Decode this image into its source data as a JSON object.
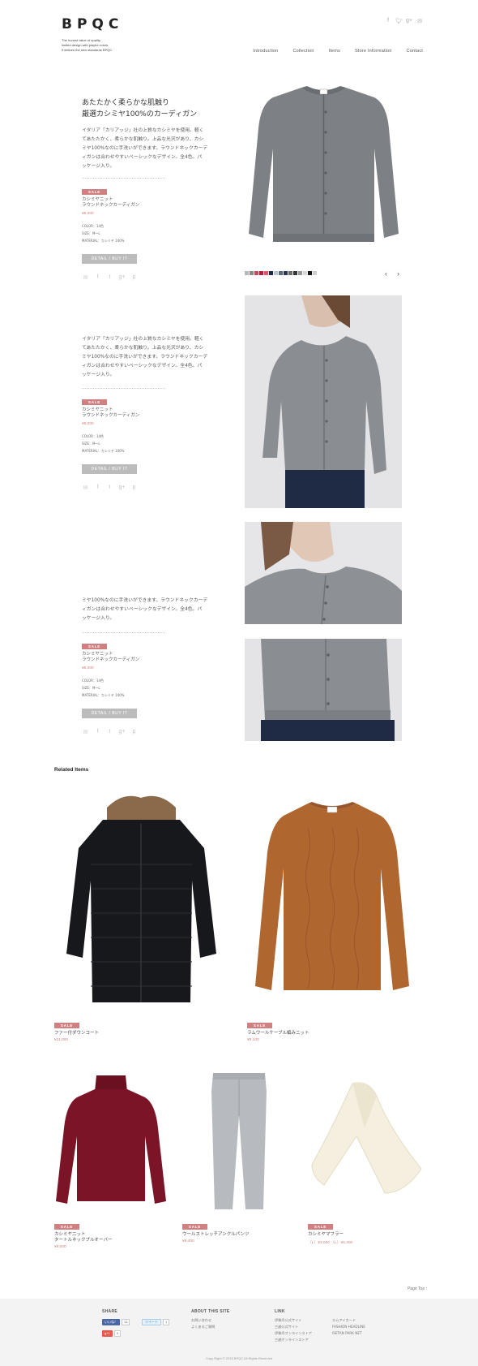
{
  "header": {
    "logo": "BPQC",
    "tagline": [
      "The honest value of quality,",
      "limited design with playful colors,",
      "it defines the new standards BPQC."
    ],
    "nav": [
      "Introduction",
      "Collection",
      "Items",
      "Store Information",
      "Contact"
    ],
    "social_icons": [
      "facebook-icon",
      "twitter-icon",
      "googleplus-icon",
      "mail-icon"
    ]
  },
  "feature": {
    "title": [
      "あたたかく柔らかな肌触り",
      "厳選カシミヤ100%のカーディガン"
    ],
    "body": [
      "イタリア「カリアッジ」社の上質なカシミヤを使用。軽く",
      "てあたたかく、柔らかな肌触り。上品な光沢があり、カシ",
      "ミヤ100%なのに手洗いができます。ラウンドネックカーデ",
      "ィガンは合わせやすいベーシックなデザイン。全4色。パ",
      "ッケージ入り。"
    ],
    "body_2": [
      "イタリア「カリアッジ」社の上質なカシミヤを使用。軽く",
      "てあたたかく、柔らかな肌触り。上品な光沢があり、カシ",
      "ミヤ100%なのに手洗いができます。ラウンドネックカーデ",
      "ィガンは合わせやすいベーシックなデザイン。全4色。パ",
      "ッケージ入り。"
    ],
    "body_3": [
      "ミヤ100%なのに手洗いができます。ラウンドネックカーデ",
      "ィガンは合わせやすいベーシックなデザイン。全4色。パ",
      "ッケージ入り。"
    ],
    "sale": "SALE",
    "product_name": [
      "カシミヤニット",
      "ラウンドネックカーディガン"
    ],
    "price": "¥9,000",
    "specs": [
      "COLOR：14色",
      "SIZE：M～L",
      "MATERIAL：カシミヤ 100%"
    ],
    "button": "DETAIL / BUY IT",
    "share_icons": [
      "mail-icon",
      "facebook-icon",
      "twitter-icon",
      "googleplus-icon",
      "pinterest-icon"
    ],
    "swatch_colors": [
      "#b8b8b8",
      "#8a8a8a",
      "#c64a59",
      "#a9243a",
      "#e0556b",
      "#1a2a4a",
      "#b9c4d4",
      "#5a6a7c",
      "#2b3450",
      "#6b6b6b",
      "#353535",
      "#9a9a9a",
      "#d8d8d8",
      "#151515",
      "#cfcfcf"
    ],
    "arrows": [
      "‹",
      "›"
    ]
  },
  "related": {
    "title": "Related Items",
    "items": [
      {
        "sale": "SALE",
        "name": [
          "ファー付ダウンコート"
        ],
        "price": "¥11,000"
      },
      {
        "sale": "SALE",
        "name": [
          "ラムウールケーブル編みニット"
        ],
        "price": "¥5,100"
      },
      {
        "sale": "SALE",
        "name": [
          "カシミヤニット",
          "タートルネックプルオーバー"
        ],
        "price": "¥9,000"
      },
      {
        "sale": "SALE",
        "name": [
          "ウールストレッチアンクルパンツ"
        ],
        "price": "¥6,400"
      },
      {
        "sale": "SALE",
        "name": [
          "カシミヤマフラー"
        ],
        "price": "（L）¥3,000 （L）¥5,400"
      }
    ]
  },
  "pagetop": "Page Top ↑",
  "footer": {
    "share_title": "SHARE",
    "like_label": "いいね！",
    "like_count": "13",
    "tweet_label": "ツイート",
    "tweet_count": "1",
    "gplus_label": "g+1",
    "gplus_count": "0",
    "about_title": "ABOUT THIS SITE",
    "about_links": [
      "お問い合わせ",
      "よくあるご質問"
    ],
    "link_title": "LINK",
    "links_col1": [
      "伊勢丹公式サイト",
      "三越公式サイト",
      "伊勢丹オンラインストア",
      "三越オンラインストア"
    ],
    "links_col2": [
      "エムアイカード",
      "FASHION HEADLINE",
      "ISETAN PARK NET"
    ],
    "copyright": "Copy Right © 2015 BPQC All Rights Reserved"
  },
  "colors": {
    "accent": "#d08080",
    "button": "#bcbcbc",
    "footer_bg": "#f3f3f3"
  }
}
